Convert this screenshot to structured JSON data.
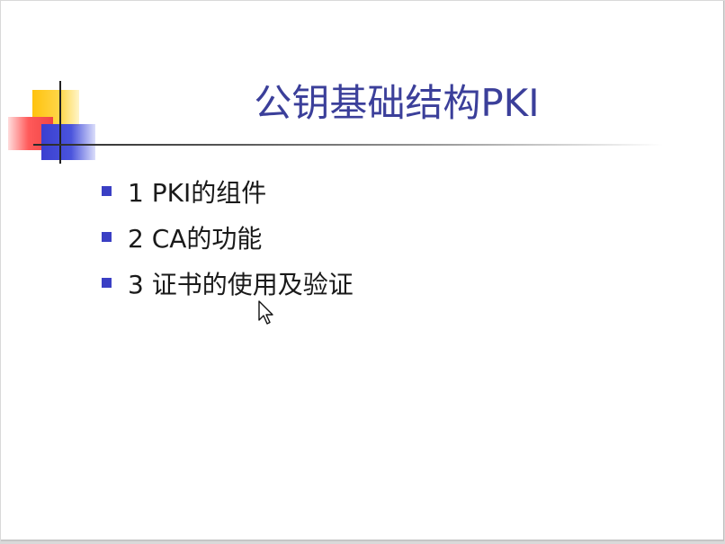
{
  "slide": {
    "title": "公钥基础结构PKI",
    "bullets": [
      {
        "label": "1 PKI的组件"
      },
      {
        "label": "2 CA的功能"
      },
      {
        "label": "3 证书的使用及验证"
      }
    ]
  },
  "colors": {
    "title": "#3b3f9a",
    "bullet": "#3a3fc4",
    "logo_yellow": "#ffc20e",
    "logo_red": "#f04545",
    "logo_blue": "#3a3fd0"
  },
  "icons": {
    "cursor": "mouse-pointer-icon",
    "logo": "corner-squares-logo"
  }
}
